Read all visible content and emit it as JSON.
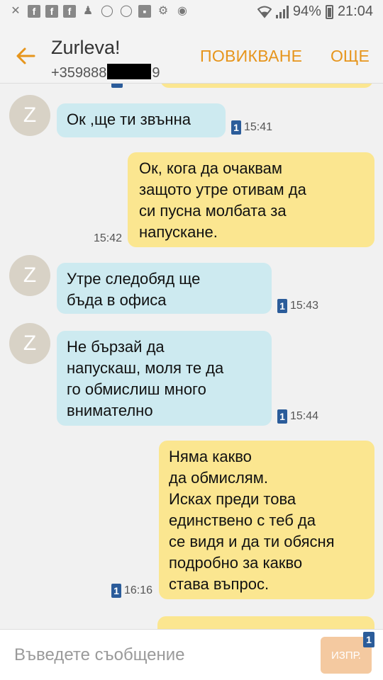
{
  "status_bar": {
    "battery": "94%",
    "time": "21:04",
    "icons": [
      "missed-call-icon",
      "facebook-icon",
      "facebook-icon",
      "facebook-icon",
      "add-contact-icon",
      "viber-icon",
      "whatsapp-icon",
      "gallery-icon",
      "settings-icon",
      "messenger-icon"
    ]
  },
  "header": {
    "contact_name": "Zurleva!",
    "number_prefix": "+359888",
    "number_suffix": "9",
    "call_label": "ПОВИКВАНЕ",
    "more_label": "ОЩЕ"
  },
  "messages": [
    {
      "direction": "in",
      "avatar": "Z",
      "text": "Ок ,ще ти звънна",
      "time": "15:41",
      "sim": "1"
    },
    {
      "direction": "out",
      "text": "Ок, кога да очаквам\nзащото утре отивам да\nси пусна молбата за\nнапускане.",
      "time": "15:42"
    },
    {
      "direction": "in",
      "avatar": "Z",
      "text": "Утре следобяд ще\nбъда в офиса",
      "time": "15:43",
      "sim": "1"
    },
    {
      "direction": "in",
      "avatar": "Z",
      "text": "Не бързай да\nнапускаш, моля те да\nго обмислиш много\nвнимателно",
      "time": "15:44",
      "sim": "1"
    },
    {
      "direction": "out",
      "text": "Няма какво\nда обмислям.\nИсках преди това\nединствено с теб да\nсе видя и да ти обясня\nподробно за какво\nстава въпрос.",
      "time": "16:16",
      "sim": "1"
    }
  ],
  "input": {
    "placeholder": "Въведете съобщение",
    "send_label": "ИЗПР.",
    "send_sim": "1"
  },
  "colors": {
    "accent": "#e6951c",
    "incoming_bubble": "#cdeaf0",
    "outgoing_bubble": "#fbe690",
    "sim_badge": "#2b5c9a"
  }
}
